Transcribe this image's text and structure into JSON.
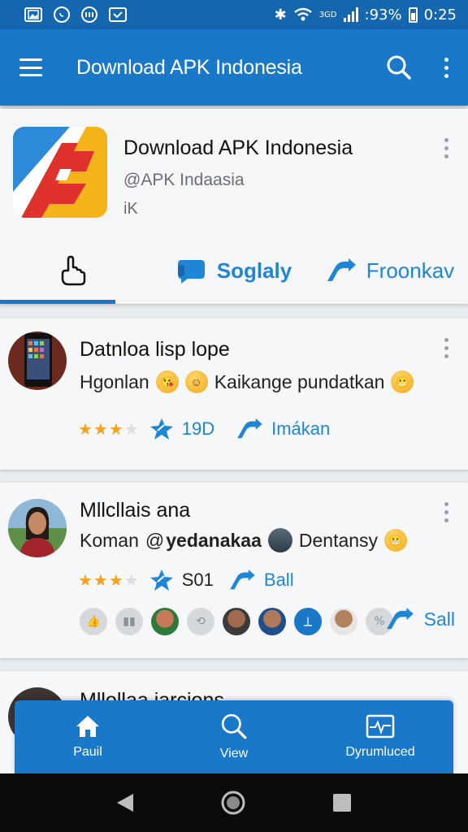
{
  "status_bar": {
    "left_icons": [
      "gallery-icon",
      "whatsapp-icon",
      "messenger-icon",
      "mail-icon"
    ],
    "small_label": "3GD",
    "battery_percent": ":93%",
    "time": "0:25"
  },
  "app_bar": {
    "title": "Download APK Indonesia"
  },
  "profile": {
    "name": "Download APK Indonesia",
    "handle": "@APK Indaasia",
    "extra": "iK",
    "tabs": [
      {
        "label": "",
        "icon": "hand-pointer-icon",
        "active": true
      },
      {
        "label": "Soglaly",
        "icon": "chat-icon",
        "active": false
      },
      {
        "label": "Froonkav",
        "icon": "send-icon",
        "active": false
      }
    ]
  },
  "posts": [
    {
      "title": "Datnloa lisp lope",
      "text_a": "Hgonlan",
      "text_b": "Kaikange pundatkan",
      "stars_filled": 3,
      "stars_total": 4,
      "count": "19D",
      "action": "Imákan"
    },
    {
      "title": "Mllcllais ana",
      "text_a": "Koman",
      "text_handle": "@",
      "text_bold": "yedanakaa",
      "text_b": "Dentansy",
      "stars_filled": 3,
      "stars_total": 4,
      "count": "S01",
      "action": "Ball",
      "share": "Sall"
    },
    {
      "title": "Mllollaa iarcions"
    }
  ],
  "bottom_nav": [
    {
      "label": "Pauil",
      "icon": "home-icon"
    },
    {
      "label": "View",
      "icon": "search-icon"
    },
    {
      "label": "Dyrumluced",
      "icon": "pulse-icon"
    }
  ],
  "colors": {
    "status_bar": "#1466ae",
    "app_bar": "#1a78c8",
    "accent": "#1f86d6",
    "star": "#f4a21f"
  }
}
